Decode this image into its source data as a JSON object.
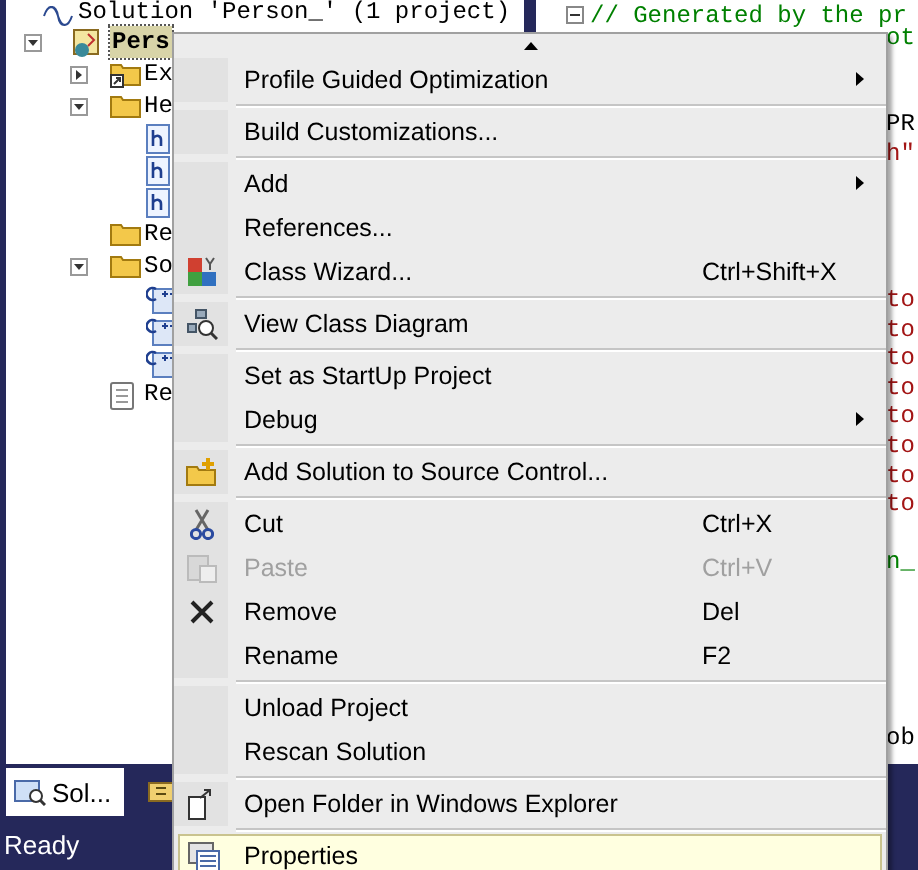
{
  "solution_explorer": {
    "solution": "Solution 'Person_' (1 project)",
    "project": {
      "label": "Pers",
      "selected": true,
      "expanded": true,
      "children": [
        {
          "kind": "dependencies",
          "label": "Ex",
          "expanded": false
        },
        {
          "kind": "folder",
          "label": "He",
          "expanded": true,
          "children": [
            {
              "kind": "header-file"
            },
            {
              "kind": "header-file"
            },
            {
              "kind": "header-file"
            }
          ]
        },
        {
          "kind": "folder",
          "label": "Re"
        },
        {
          "kind": "folder",
          "label": "So",
          "expanded": true,
          "children": [
            {
              "kind": "cpp-file"
            },
            {
              "kind": "cpp-file"
            },
            {
              "kind": "cpp-file"
            }
          ]
        },
        {
          "kind": "text-file",
          "label": "Re"
        }
      ]
    },
    "tabs": [
      {
        "label": "Sol...",
        "selected": true
      },
      {
        "selected": false
      }
    ]
  },
  "editor": {
    "first_line": "// Generated by the pr",
    "fragments": [
      {
        "text": "ot",
        "kind": "comment"
      },
      {
        "text": "PR",
        "kind": "plain"
      },
      {
        "text": "h\"",
        "kind": "string"
      },
      {
        "text": "to",
        "kind": "string"
      },
      {
        "text": "to",
        "kind": "string"
      },
      {
        "text": "to",
        "kind": "string"
      },
      {
        "text": "to",
        "kind": "string"
      },
      {
        "text": "to",
        "kind": "string"
      },
      {
        "text": "to",
        "kind": "string"
      },
      {
        "text": "to",
        "kind": "string"
      },
      {
        "text": "to",
        "kind": "string"
      },
      {
        "text": "n_",
        "kind": "comment"
      },
      {
        "text": "ob",
        "kind": "plain"
      }
    ]
  },
  "context_menu": {
    "groups": [
      [
        {
          "label": "Profile Guided Optimization",
          "submenu": true,
          "disabled": false,
          "selected": false
        }
      ],
      [
        {
          "label": "Build Customizations...",
          "submenu": false,
          "disabled": false,
          "selected": false
        }
      ],
      [
        {
          "label": "Add",
          "submenu": true,
          "disabled": false,
          "selected": false
        },
        {
          "label": "References...",
          "submenu": false,
          "disabled": false,
          "selected": false
        },
        {
          "label": "Class Wizard...",
          "shortcut": "Ctrl+Shift+X",
          "submenu": false,
          "disabled": false,
          "selected": false
        }
      ],
      [
        {
          "label": "View Class Diagram",
          "submenu": false,
          "disabled": false,
          "selected": false
        }
      ],
      [
        {
          "label": "Set as StartUp Project",
          "submenu": false,
          "disabled": false,
          "selected": false
        },
        {
          "label": "Debug",
          "submenu": true,
          "disabled": false,
          "selected": false
        }
      ],
      [
        {
          "label": "Add Solution to Source Control...",
          "submenu": false,
          "disabled": false,
          "selected": false
        }
      ],
      [
        {
          "label": "Cut",
          "shortcut": "Ctrl+X",
          "submenu": false,
          "disabled": false,
          "selected": false
        },
        {
          "label": "Paste",
          "shortcut": "Ctrl+V",
          "submenu": false,
          "disabled": true,
          "selected": false
        },
        {
          "label": "Remove",
          "shortcut": "Del",
          "submenu": false,
          "disabled": false,
          "selected": false
        },
        {
          "label": "Rename",
          "shortcut": "F2",
          "submenu": false,
          "disabled": false,
          "selected": false
        }
      ],
      [
        {
          "label": "Unload Project",
          "submenu": false,
          "disabled": false,
          "selected": false
        },
        {
          "label": "Rescan Solution",
          "submenu": false,
          "disabled": false,
          "selected": false
        }
      ],
      [
        {
          "label": "Open Folder in Windows Explorer",
          "submenu": false,
          "disabled": false,
          "selected": false
        }
      ],
      [
        {
          "label": "Properties",
          "submenu": false,
          "disabled": false,
          "selected": true
        }
      ]
    ]
  },
  "status_bar": "Ready"
}
